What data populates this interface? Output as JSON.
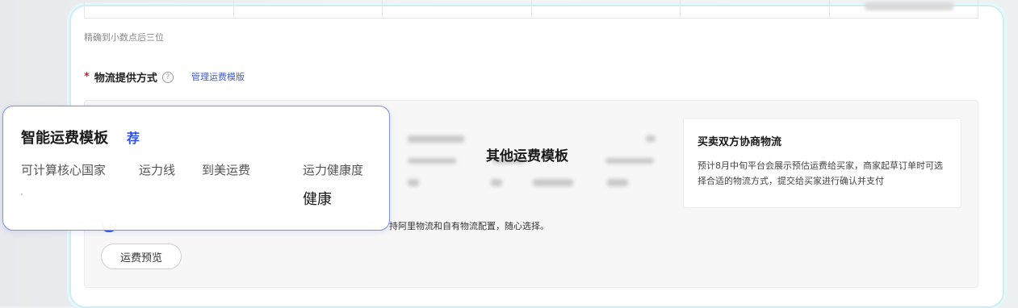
{
  "precision_hint": "精确到小数点后三位",
  "logistics": {
    "required_mark": "*",
    "label": "物流提供方式",
    "help_icon": "question-circle-icon",
    "manage_link": "管理运费模版"
  },
  "smart_template": {
    "title": "智能运费模板",
    "tag": "荐",
    "columns": [
      "可计算核心国家",
      "运力线",
      "到美运费",
      "运力健康度"
    ],
    "health_value": "健康"
  },
  "other_template": {
    "title": "其他运费模板"
  },
  "negotiated": {
    "title": "买卖双方协商物流",
    "description": "预计8月中旬平台会展示预估运费给买家，商家起草订单时可选择合适的物流方式，提交给买家进行确认并支付"
  },
  "option_text": "持阿里物流和自有物流配置，随心选择。",
  "preview_button": "运费预览",
  "colors": {
    "accent": "#2f54eb",
    "link": "#3d5bd9",
    "required": "#e02020",
    "card_border": "#7d8cf0"
  }
}
